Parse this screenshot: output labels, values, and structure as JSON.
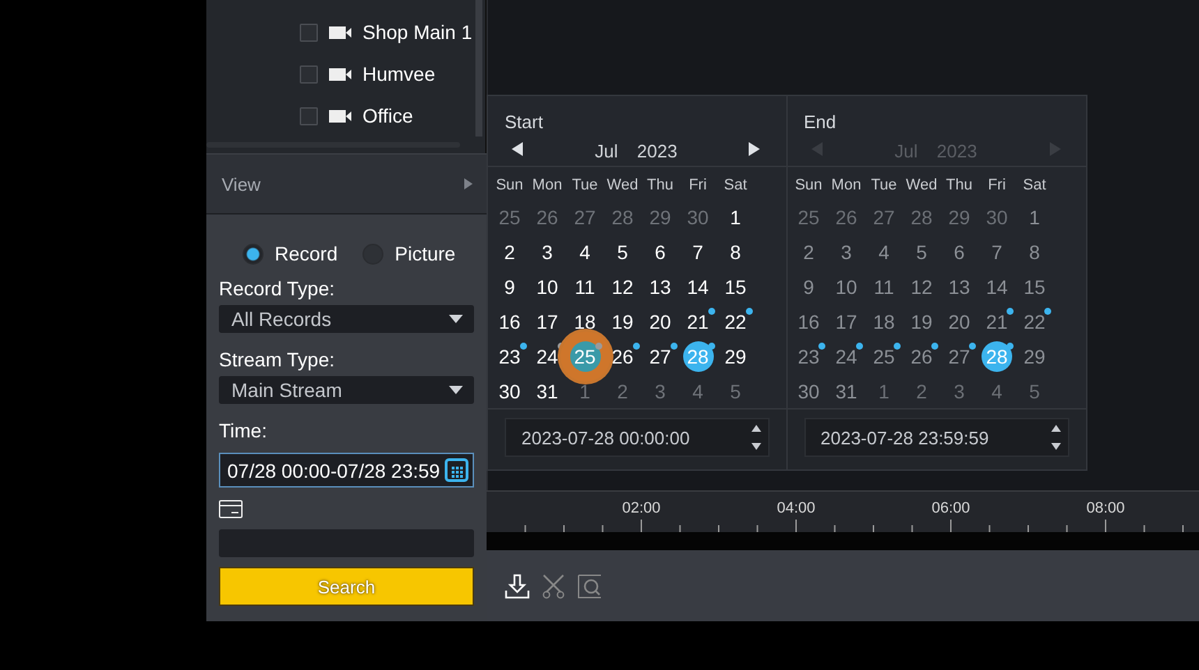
{
  "tree": {
    "items": [
      {
        "label": "Shop Main 1",
        "checked": false
      },
      {
        "label": "Humvee",
        "checked": false
      },
      {
        "label": "Office",
        "checked": false
      }
    ]
  },
  "view_section": {
    "label": "View",
    "expanded": false
  },
  "search_form": {
    "modes": [
      {
        "label": "Record",
        "selected": true
      },
      {
        "label": "Picture",
        "selected": false
      }
    ],
    "record_type": {
      "label": "Record Type:",
      "value": "All Records"
    },
    "stream_type": {
      "label": "Stream Type:",
      "value": "Main Stream"
    },
    "time": {
      "label": "Time:",
      "value": "07/28 00:00-07/28 23:59",
      "focused": true
    },
    "search_button": "Search"
  },
  "calendars": [
    {
      "title": "Start",
      "month": "Jul",
      "year": "2023",
      "disabled": false,
      "weekdays": [
        "Sun",
        "Mon",
        "Tue",
        "Wed",
        "Thu",
        "Fri",
        "Sat"
      ],
      "weeks": [
        [
          {
            "label": "25",
            "muted": true
          },
          {
            "label": "26",
            "muted": true
          },
          {
            "label": "27",
            "muted": true
          },
          {
            "label": "28",
            "muted": true
          },
          {
            "label": "29",
            "muted": true
          },
          {
            "label": "30",
            "muted": true
          },
          {
            "label": "1",
            "muted": false
          }
        ],
        [
          {
            "label": "2",
            "muted": false
          },
          {
            "label": "3",
            "muted": false
          },
          {
            "label": "4",
            "muted": false
          },
          {
            "label": "5",
            "muted": false
          },
          {
            "label": "6",
            "muted": false
          },
          {
            "label": "7",
            "muted": false
          },
          {
            "label": "8",
            "muted": false
          }
        ],
        [
          {
            "label": "9",
            "muted": false
          },
          {
            "label": "10",
            "muted": false
          },
          {
            "label": "11",
            "muted": false
          },
          {
            "label": "12",
            "muted": false
          },
          {
            "label": "13",
            "muted": false
          },
          {
            "label": "14",
            "muted": false
          },
          {
            "label": "15",
            "muted": false
          }
        ],
        [
          {
            "label": "16",
            "muted": false
          },
          {
            "label": "17",
            "muted": false
          },
          {
            "label": "18",
            "muted": false
          },
          {
            "label": "19",
            "muted": false
          },
          {
            "label": "20",
            "muted": false
          },
          {
            "label": "21",
            "muted": false,
            "color": "#3cb4ee"
          },
          {
            "label": "22",
            "muted": false,
            "color": "#3cb4ee"
          }
        ],
        [
          {
            "label": "23",
            "muted": false,
            "color": "#3cb4ee"
          },
          {
            "label": "24",
            "muted": false,
            "color": "#9a9a9a"
          },
          {
            "label": "25",
            "muted": false,
            "color": "#9a9a9a",
            "hovered": true
          },
          {
            "label": "26",
            "muted": false,
            "color": "#3cb4ee"
          },
          {
            "label": "27",
            "muted": false,
            "color": "#3cb4ee"
          },
          {
            "label": "28",
            "muted": false,
            "color": "#3cb4ee",
            "selected": true
          },
          {
            "label": "29",
            "muted": false
          }
        ],
        [
          {
            "label": "30",
            "muted": false
          },
          {
            "label": "31",
            "muted": false
          },
          {
            "label": "1",
            "muted": true
          },
          {
            "label": "2",
            "muted": true
          },
          {
            "label": "3",
            "muted": true
          },
          {
            "label": "4",
            "muted": true
          },
          {
            "label": "5",
            "muted": true
          }
        ]
      ],
      "time_value": "2023-07-28 00:00:00"
    },
    {
      "title": "End",
      "month": "Jul",
      "year": "2023",
      "disabled": true,
      "weekdays": [
        "Sun",
        "Mon",
        "Tue",
        "Wed",
        "Thu",
        "Fri",
        "Sat"
      ],
      "weeks": [
        [
          {
            "label": "25",
            "muted": true
          },
          {
            "label": "26",
            "muted": true
          },
          {
            "label": "27",
            "muted": true
          },
          {
            "label": "28",
            "muted": true
          },
          {
            "label": "29",
            "muted": true
          },
          {
            "label": "30",
            "muted": true
          },
          {
            "label": "1",
            "muted": false
          }
        ],
        [
          {
            "label": "2",
            "muted": false
          },
          {
            "label": "3",
            "muted": false
          },
          {
            "label": "4",
            "muted": false
          },
          {
            "label": "5",
            "muted": false
          },
          {
            "label": "6",
            "muted": false
          },
          {
            "label": "7",
            "muted": false
          },
          {
            "label": "8",
            "muted": false
          }
        ],
        [
          {
            "label": "9",
            "muted": false
          },
          {
            "label": "10",
            "muted": false
          },
          {
            "label": "11",
            "muted": false
          },
          {
            "label": "12",
            "muted": false
          },
          {
            "label": "13",
            "muted": false
          },
          {
            "label": "14",
            "muted": false
          },
          {
            "label": "15",
            "muted": false
          }
        ],
        [
          {
            "label": "16",
            "muted": false
          },
          {
            "label": "17",
            "muted": false
          },
          {
            "label": "18",
            "muted": false
          },
          {
            "label": "19",
            "muted": false
          },
          {
            "label": "20",
            "muted": false
          },
          {
            "label": "21",
            "muted": false,
            "color": "#3cb4ee"
          },
          {
            "label": "22",
            "muted": false,
            "color": "#3cb4ee"
          }
        ],
        [
          {
            "label": "23",
            "muted": false,
            "color": "#3cb4ee"
          },
          {
            "label": "24",
            "muted": false,
            "color": "#3cb4ee"
          },
          {
            "label": "25",
            "muted": false,
            "color": "#3cb4ee"
          },
          {
            "label": "26",
            "muted": false,
            "color": "#3cb4ee"
          },
          {
            "label": "27",
            "muted": false,
            "color": "#3cb4ee"
          },
          {
            "label": "28",
            "muted": false,
            "color": "#3cb4ee",
            "selected": true
          },
          {
            "label": "29",
            "muted": false
          }
        ],
        [
          {
            "label": "30",
            "muted": false
          },
          {
            "label": "31",
            "muted": false
          },
          {
            "label": "1",
            "muted": true
          },
          {
            "label": "2",
            "muted": true
          },
          {
            "label": "3",
            "muted": true
          },
          {
            "label": "4",
            "muted": true
          },
          {
            "label": "5",
            "muted": true
          }
        ]
      ],
      "time_value": "2023-07-28 23:59:59"
    }
  ],
  "timeline": {
    "labels": [
      "02:00",
      "04:00",
      "06:00",
      "08:00"
    ]
  }
}
